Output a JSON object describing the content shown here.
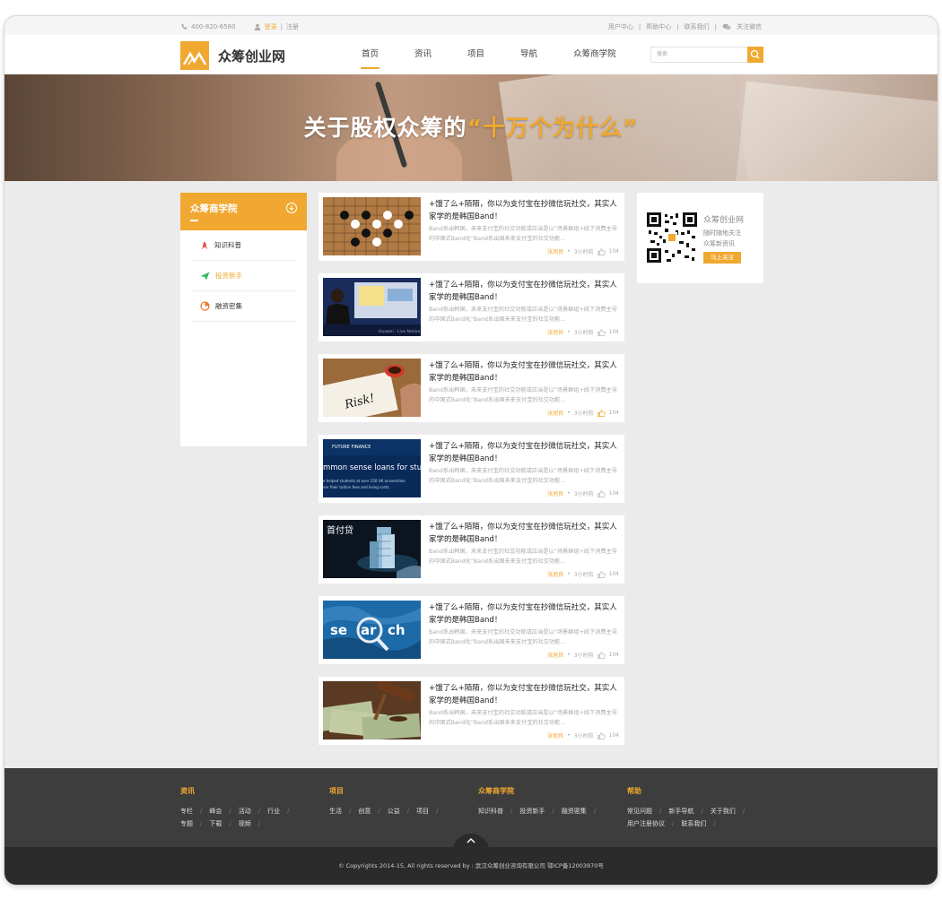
{
  "topbar": {
    "phone": "400-820-6580",
    "login": "登录",
    "register": "注册",
    "sep": "|",
    "links": [
      "用户中心",
      "帮助中心",
      "联系我们"
    ],
    "follow": "关注微信"
  },
  "header": {
    "logo_text": "众筹创业网",
    "nav": [
      "首页",
      "资讯",
      "项目",
      "导航",
      "众筹商学院"
    ],
    "search_placeholder": "搜索"
  },
  "banner": {
    "title_prefix": "关于股权众筹的",
    "title_highlight": "“十万个为什么”"
  },
  "sidebar": {
    "title": "众筹商学院",
    "items": [
      {
        "label": "知识科普"
      },
      {
        "label": "投资新手"
      },
      {
        "label": "融资密集"
      }
    ]
  },
  "articles": [
    {
      "title": "+饿了么+陌陌，你以为支付宝在抄微信玩社交，其实人家学的是韩国Band！",
      "desc": "Band系出韩国，未来支付宝的社交功能或应当是以“场景群组+线下消费主导的中国式Band化”Band系出国未来支付宝的社交功能...",
      "author": "张旭良",
      "time": "3小时前",
      "likes": "104"
    },
    {
      "title": "+饿了么+陌陌，你以为支付宝在抄微信玩社交，其实人家学的是韩国Band！",
      "desc": "Band系出韩国，未来支付宝的社交功能或应当是以“场景群组+线下消费主导的中国式Band化”Band系出国未来支付宝的社交功能...",
      "author": "张旭良",
      "time": "3小时前",
      "likes": "104"
    },
    {
      "title": "+饿了么+陌陌，你以为支付宝在抄微信玩社交，其实人家学的是韩国Band！",
      "desc": "Band系出韩国，未来支付宝的社交功能或应当是以“场景群组+线下消费主导的中国式Band化”Band系出国未来支付宝的社交功能...",
      "author": "张旭良",
      "time": "3小时前",
      "likes": "104"
    },
    {
      "title": "+饿了么+陌陌，你以为支付宝在抄微信玩社交，其实人家学的是韩国Band！",
      "desc": "Band系出韩国，未来支付宝的社交功能或应当是以“场景群组+线下消费主导的中国式Band化”Band系出国未来支付宝的社交功能...",
      "author": "张旭良",
      "time": "3小时前",
      "likes": "104"
    },
    {
      "title": "+饿了么+陌陌，你以为支付宝在抄微信玩社交，其实人家学的是韩国Band！",
      "desc": "Band系出韩国，未来支付宝的社交功能或应当是以“场景群组+线下消费主导的中国式Band化”Band系出国未来支付宝的社交功能...",
      "author": "张旭良",
      "time": "3小时前",
      "likes": "104"
    },
    {
      "title": "+饿了么+陌陌，你以为支付宝在抄微信玩社交，其实人家学的是韩国Band！",
      "desc": "Band系出韩国，未来支付宝的社交功能或应当是以“场景群组+线下消费主导的中国式Band化”Band系出国未来支付宝的社交功能...",
      "author": "张旭良",
      "time": "3小时前",
      "likes": "104"
    },
    {
      "title": "+饿了么+陌陌，你以为支付宝在抄微信玩社交，其实人家学的是韩国Band！",
      "desc": "Band系出韩国，未来支付宝的社交功能或应当是以“场景群组+线下消费主导的中国式Band化”Band系出国未来支付宝的社交功能...",
      "author": "张旭良",
      "time": "3小时前",
      "likes": "104"
    }
  ],
  "thumbs": {
    "finance_brand": "FUTURE FINANCE",
    "finance_headline": "mmon sense loans for studer",
    "finance_sub1": "e helped students at over 150 UK universities",
    "finance_sub2": "ver their tuition fees and living costs.",
    "shoufudai": "首付贷",
    "search_a": "se",
    "search_b": "ar",
    "search_c": "ch",
    "risk": "Risk!"
  },
  "qr": {
    "name": "众筹创业网",
    "line1": "随时随地关注",
    "line2": "众筹新资讯",
    "button": "马上关注"
  },
  "footer": {
    "columns": [
      {
        "title": "资讯",
        "rows": [
          [
            "专栏",
            "峰会",
            "活动",
            "行业"
          ],
          [
            "专题",
            "下载",
            "视频"
          ]
        ]
      },
      {
        "title": "项目",
        "rows": [
          [
            "生活",
            "创意",
            "公益",
            "项目"
          ]
        ]
      },
      {
        "title": "众筹商学院",
        "rows": [
          [
            "知识科普",
            "投资新手",
            "融资密集"
          ]
        ]
      },
      {
        "title": "帮助",
        "rows": [
          [
            "常见问题",
            "新手导航",
            "关于我们"
          ],
          [
            "用户注册协议",
            "联系我们"
          ]
        ]
      }
    ],
    "separator": "/",
    "totop": "^",
    "copyright": "© Copyrights 2014-15, All rights reserved by : 武汉众筹创业咨询有限公司 鄂ICP备12003970号"
  },
  "colors": {
    "accent": "#f0a830",
    "footer_bg": "#3d3d3d",
    "copyright_bg": "#2b2b2b"
  }
}
